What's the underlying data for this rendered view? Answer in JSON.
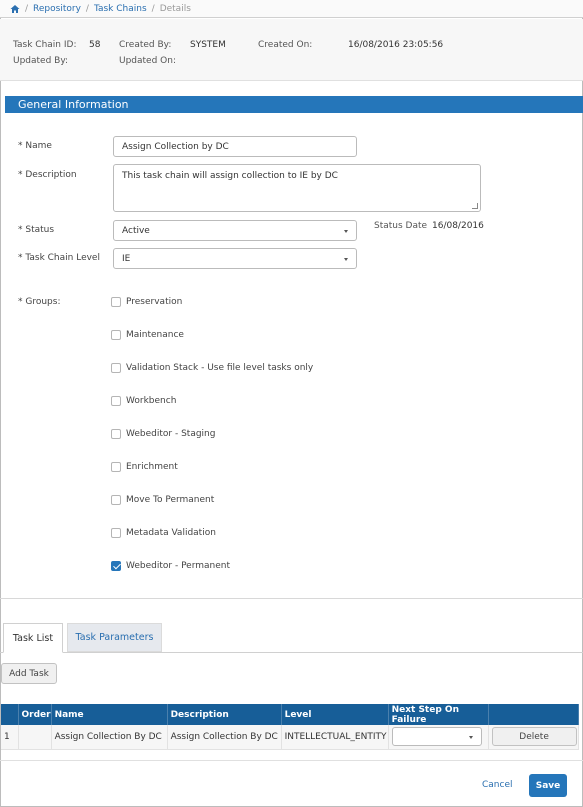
{
  "breadcrumb": {
    "items": [
      "Repository",
      "Task Chains",
      "Details"
    ]
  },
  "info": {
    "task_chain_id_label": "Task Chain ID:",
    "task_chain_id": "58",
    "created_by_label": "Created By:",
    "created_by": "SYSTEM",
    "created_on_label": "Created On:",
    "created_on": "16/08/2016 23:05:56",
    "updated_by_label": "Updated By:",
    "updated_on_label": "Updated On:"
  },
  "section": {
    "title": "General Information"
  },
  "form": {
    "name_label": "* Name",
    "name_value": "Assign Collection by DC",
    "description_label": "* Description",
    "description_value": "This task chain will assign collection to IE by DC",
    "status_label": "* Status",
    "status_value": "Active",
    "status_date_label": "Status Date",
    "status_date": "16/08/2016",
    "level_label": "* Task Chain Level",
    "level_value": "IE",
    "groups_label": "* Groups:",
    "groups": [
      {
        "label": "Preservation",
        "checked": false
      },
      {
        "label": "Maintenance",
        "checked": false
      },
      {
        "label": "Validation Stack - Use file level tasks only",
        "checked": false
      },
      {
        "label": "Workbench",
        "checked": false
      },
      {
        "label": "Webeditor - Staging",
        "checked": false
      },
      {
        "label": "Enrichment",
        "checked": false
      },
      {
        "label": "Move To Permanent",
        "checked": false
      },
      {
        "label": "Metadata Validation",
        "checked": false
      },
      {
        "label": "Webeditor - Permanent",
        "checked": true
      }
    ]
  },
  "tabs": [
    {
      "label": "Task List"
    },
    {
      "label": "Task Parameters"
    }
  ],
  "add_task_label": "Add Task",
  "table": {
    "headers": [
      "",
      "Order",
      "Name",
      "Description",
      "Level",
      "Next Step On Failure",
      ""
    ],
    "rows": [
      {
        "index": "1",
        "order": "",
        "name": "Assign Collection By DC",
        "description": "Assign Collection By DC",
        "level": "INTELLECTUAL_ENTITY",
        "next_step": "",
        "delete_label": "Delete"
      }
    ]
  },
  "footer": {
    "cancel_label": "Cancel",
    "save_label": "Save"
  },
  "colors": {
    "accent": "#2576ba",
    "table_header": "#175e98"
  }
}
